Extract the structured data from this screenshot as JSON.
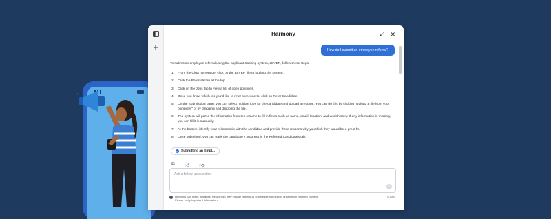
{
  "window": {
    "title": "Harmony",
    "toggle_icon": "sidebar-toggle-icon",
    "new_chat_icon": "plus-icon",
    "expand_icon": "expand-icon",
    "close_icon": "close-icon"
  },
  "user_message": "How do I submit an employee referral?",
  "answer": {
    "intro": "To submit an employee referral using the applicant tracking system, LEVER, follow these steps:",
    "steps": [
      {
        "num": "1.",
        "text": "From the Okta homepage, click on the LEVER tile to log into the system."
      },
      {
        "num": "2.",
        "text": "Click the Referrals tab at the top."
      },
      {
        "num": "3.",
        "text": "Click on the Jobs tab to view a list of open positions."
      },
      {
        "num": "4.",
        "text": "Once you know which job you'd like to refer someone to, click on Refer Candidate."
      },
      {
        "num": "5.",
        "text": "On the Submission page, you can select multiple jobs for the candidate and upload a resume. You can do this by clicking \"Upload a file from your computer\" or by dragging and dropping the file."
      },
      {
        "num": "6.",
        "text": "The system will parse the information from the resume to fill in fields such as name, email, location, and work history. If any information is missing, you can fill it in manually."
      },
      {
        "num": "7.",
        "text": "At the bottom, identify your relationship with the candidate and provide three reasons why you think they would be a great fit."
      },
      {
        "num": "8.",
        "text": "Once submitted, you can track the candidate's progress in the Referred Candidates tab."
      }
    ]
  },
  "source_chip": {
    "label": "Submitting an Empl...",
    "icon": "document-source-icon"
  },
  "actions": {
    "copy_icon": "copy-icon",
    "like_icon": "thumbs-up-icon",
    "dislike_icon": "thumbs-down-icon"
  },
  "input": {
    "placeholder": "Ask a follow-up question",
    "value": "",
    "send_icon": "arrow-up-icon"
  },
  "disclaimer": {
    "line1": "Harmony can make mistakes. Responses may include general AI knowledge not directly drawn from platform content.",
    "line2": "Please verify important information."
  },
  "char_counter": "0/1500",
  "colors": {
    "background": "#1f3a5f",
    "accent": "#2f6fd6",
    "phone": "#2b63c6",
    "shirt": "#3a7fd1",
    "megaphone": "#2f86d8"
  }
}
